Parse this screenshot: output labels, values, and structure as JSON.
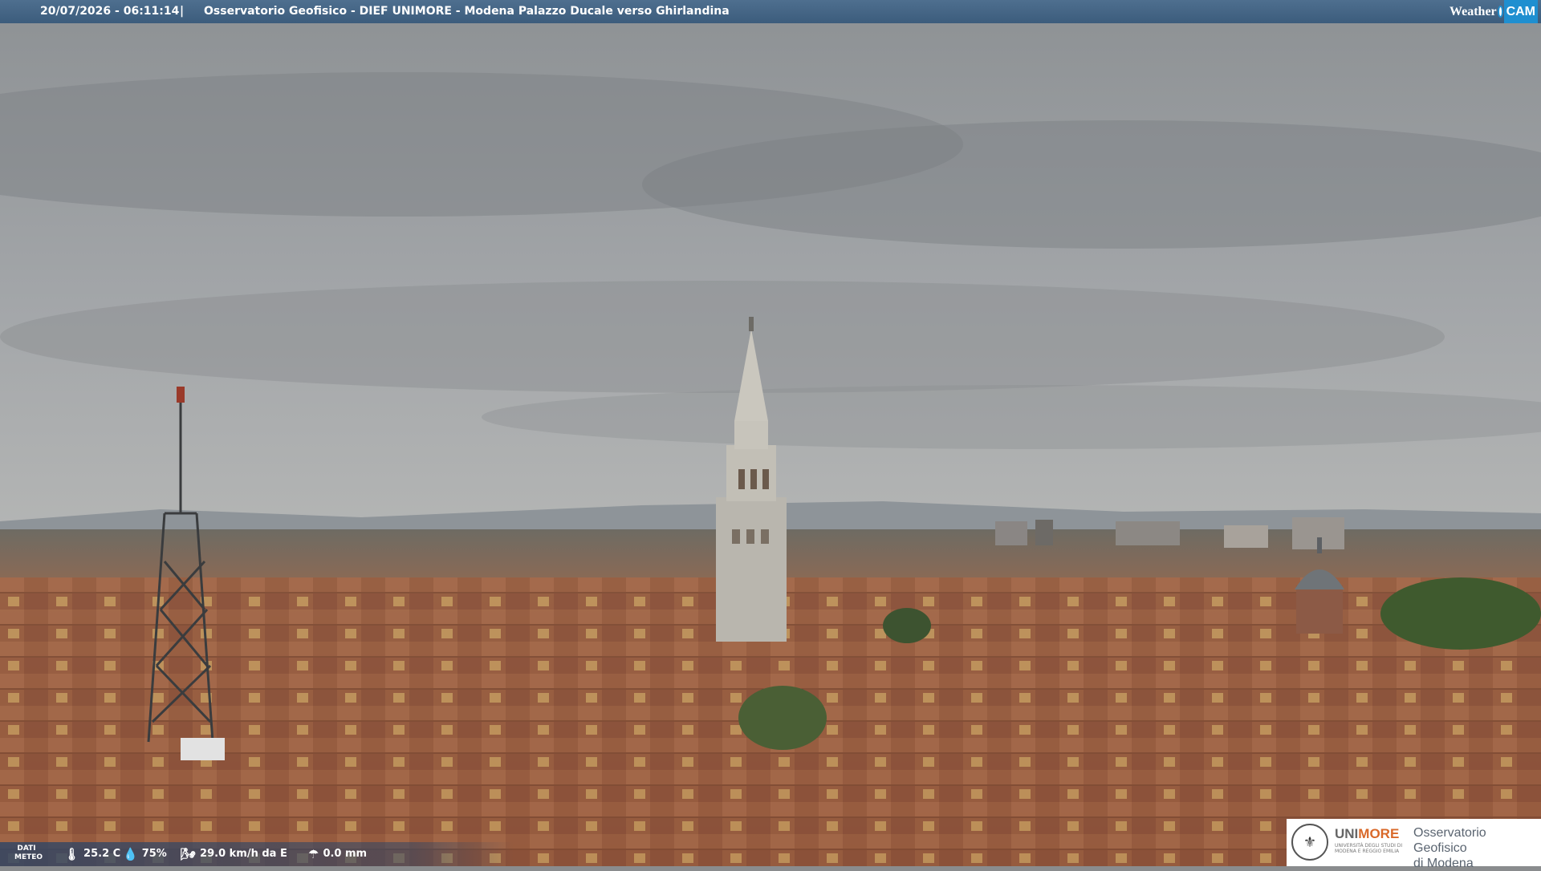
{
  "overlay": {
    "timestamp": "20/07/2026 - 06:11:14",
    "separator": "|",
    "title": "Osservatorio Geofisico - DIEF UNIMORE - Modena Palazzo Ducale verso Ghirlandina",
    "brand_word": "Weather",
    "brand_cam": "CAM"
  },
  "weather": {
    "label": "DATI METEO",
    "temperature": "25.2 C",
    "humidity": "75%",
    "wind": "29.0 km/h da E",
    "rain": "0.0 mm"
  },
  "logo": {
    "uni_a": "UNI",
    "uni_b": "MORE",
    "uni_sub": "UNIVERSITÀ DEGLI STUDI DI MODENA E REGGIO EMILIA",
    "line1": "Osservatorio Geofisico",
    "line2": "di Modena"
  },
  "colors": {
    "sky": "#a7aaad",
    "roofs": "#9c5f40",
    "brand_blue": "#1f8fd0",
    "unimore_orange": "#d9692a"
  }
}
